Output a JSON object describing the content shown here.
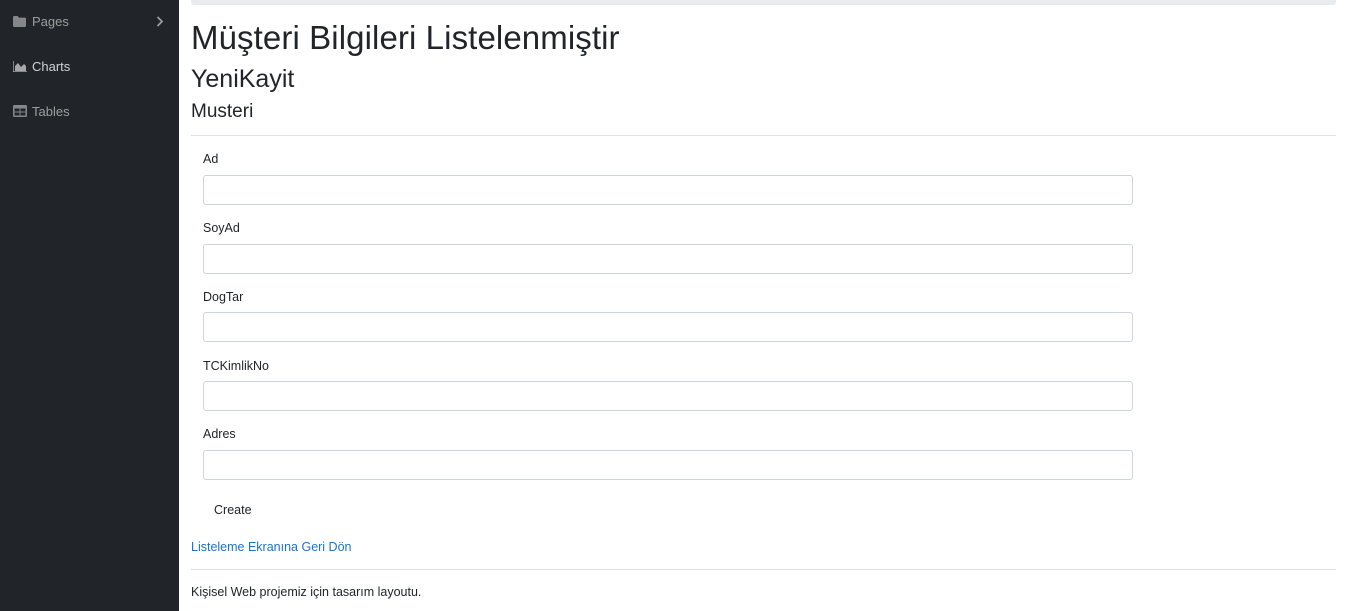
{
  "sidebar": {
    "items": [
      {
        "label": "Pages",
        "icon": "folder-icon",
        "has_chevron": true
      },
      {
        "label": "Charts",
        "icon": "chart-area-icon"
      },
      {
        "label": "Tables",
        "icon": "table-icon"
      }
    ]
  },
  "main": {
    "title": "Müşteri Bilgileri Listelenmiştir",
    "subtitle": "YeniKayit",
    "section": "Musteri",
    "form": {
      "fields": [
        {
          "label": "Ad",
          "value": ""
        },
        {
          "label": "SoyAd",
          "value": ""
        },
        {
          "label": "DogTar",
          "value": ""
        },
        {
          "label": "TCKimlikNo",
          "value": ""
        },
        {
          "label": "Adres",
          "value": ""
        }
      ],
      "submit_label": "Create"
    },
    "back_link": "Listeleme Ekranına Geri Dön"
  },
  "footer": {
    "text": "Kişisel Web projemiz için tasarım layoutu."
  },
  "colors": {
    "sidebar_bg": "#212529",
    "link": "#1d73c9",
    "border": "#ced4da"
  }
}
